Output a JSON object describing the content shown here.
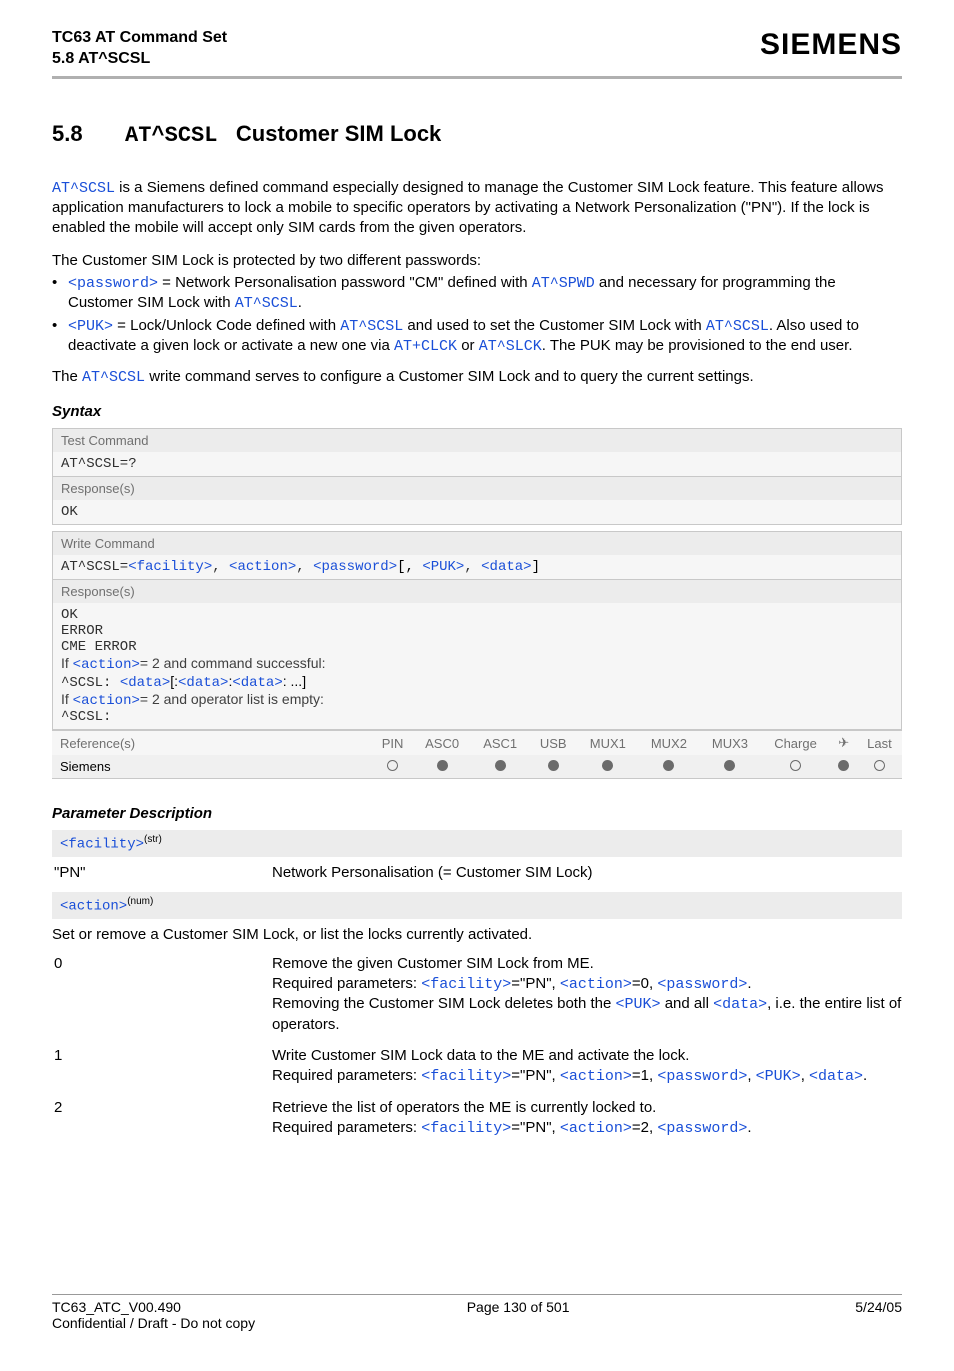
{
  "header": {
    "title_line1": "TC63 AT Command Set",
    "title_line2": "5.8 AT^SCSL",
    "brand": "SIEMENS"
  },
  "section": {
    "number": "5.8",
    "command": "AT^SCSL",
    "title": "Customer SIM Lock"
  },
  "intro": {
    "cmd": "AT^SCSL",
    "text_after_cmd": " is a Siemens defined command especially designed to manage the Customer SIM Lock feature. This feature allows application manufacturers to lock a mobile to specific operators by activating a Network Personalization (\"PN\"). If the lock is enabled the mobile will accept only SIM cards from the given operators."
  },
  "protected_intro": "The Customer SIM Lock is protected by two different passwords:",
  "bullet1": {
    "p_password": "<password>",
    "t1": " = Network Personalisation password \"CM\" defined with ",
    "p_spwd": "AT^SPWD",
    "t2": " and necessary for programming the Customer SIM Lock with ",
    "p_scsl": "AT^SCSL",
    "t3": "."
  },
  "bullet2": {
    "p_puk": "<PUK>",
    "t1": " = Lock/Unlock Code defined with ",
    "p_scsl1": "AT^SCSL",
    "t2": " and used to set the Customer SIM Lock with ",
    "p_scsl2": "AT^SCSL",
    "t3": ". Also used to deactivate a given lock or activate a new one via ",
    "p_clck": "AT+CLCK",
    "t_or": " or ",
    "p_slck": "AT^SLCK",
    "t4": ". The PUK may be provisioned to the end user."
  },
  "write_cmd_intro": {
    "t0": "The ",
    "p_scsl": "AT^SCSL",
    "t1": " write command serves to configure a Customer SIM Lock and to query the current settings."
  },
  "syntax_heading": "Syntax",
  "syntax": {
    "test_label": "Test Command",
    "test_cmd": "AT^SCSL=?",
    "responses_label": "Response(s)",
    "ok": "OK",
    "write_label": "Write Command",
    "write_cmd_prefix": "AT^SCSL=",
    "p_facility": "<facility>",
    "write_c1": ", ",
    "p_action": "<action>",
    "write_c2": ", ",
    "p_password": "<password>",
    "write_b1": "[, ",
    "p_puk": "<PUK>",
    "write_c3": ", ",
    "p_data": "<data>",
    "write_b2": "]",
    "resp_ok": "OK",
    "resp_error": "ERROR",
    "resp_cme": "CME ERROR",
    "resp_if1a": "If ",
    "resp_if1_action": "<action>",
    "resp_if1b": "= 2 and command successful:",
    "resp_scsl_prefix": "^SCSL: ",
    "resp_data1": "<data>",
    "resp_b_open": "[:",
    "resp_data2": "<data>",
    "resp_colon": ":",
    "resp_data3": "<data>",
    "resp_dots": ": ...]",
    "resp_if2a": "If ",
    "resp_if2_action": "<action>",
    "resp_if2b": "= 2 and operator list is empty:",
    "resp_scsl_empty": "^SCSL:"
  },
  "ref_table": {
    "headers": [
      "Reference(s)",
      "PIN",
      "ASC0",
      "ASC1",
      "USB",
      "MUX1",
      "MUX2",
      "MUX3",
      "Charge",
      "✈",
      "Last"
    ],
    "row_label": "Siemens",
    "row_values": [
      "open",
      "filled",
      "filled",
      "filled",
      "filled",
      "filled",
      "filled",
      "open",
      "filled",
      "open"
    ]
  },
  "param_heading": "Parameter Description",
  "param_facility": {
    "header_tag": "<facility>",
    "header_sup": "(str)",
    "key": "\"PN\"",
    "val": "Network Personalisation (= Customer SIM Lock)"
  },
  "param_action": {
    "header_tag": "<action>",
    "header_sup": "(num)",
    "intro": "Set or remove a Customer SIM Lock, or list the locks currently activated.",
    "row0": {
      "key": "0",
      "l1": "Remove the given Customer SIM Lock from ME.",
      "l2a": "Required parameters: ",
      "p_fac": "<facility>",
      "l2b": "=\"PN\", ",
      "p_act": "<action>",
      "l2c": "=0, ",
      "p_pwd": "<password>",
      "l2d": ".",
      "l3a": "Removing the Customer SIM Lock deletes both the ",
      "p_puk": "<PUK>",
      "l3b": " and all ",
      "p_data": "<data>",
      "l3c": ", i.e. the entire list of operators."
    },
    "row1": {
      "key": "1",
      "l1": "Write Customer SIM Lock data to the ME and activate the lock.",
      "l2a": "Required parameters: ",
      "p_fac": "<facility>",
      "l2b": "=\"PN\", ",
      "p_act": "<action>",
      "l2c": "=1, ",
      "p_pwd": "<password>",
      "l2d": ", ",
      "p_puk": "<PUK>",
      "l2e": ", ",
      "p_data": "<data>",
      "l2f": "."
    },
    "row2": {
      "key": "2",
      "l1": "Retrieve the list of operators the ME is currently locked to.",
      "l2a": "Required parameters: ",
      "p_fac": "<facility>",
      "l2b": "=\"PN\", ",
      "p_act": "<action>",
      "l2c": "=2, ",
      "p_pwd": "<password>",
      "l2d": "."
    }
  },
  "footer": {
    "left": "TC63_ATC_V00.490",
    "center": "Page 130 of 501",
    "right": "5/24/05",
    "sub": "Confidential / Draft - Do not copy"
  }
}
